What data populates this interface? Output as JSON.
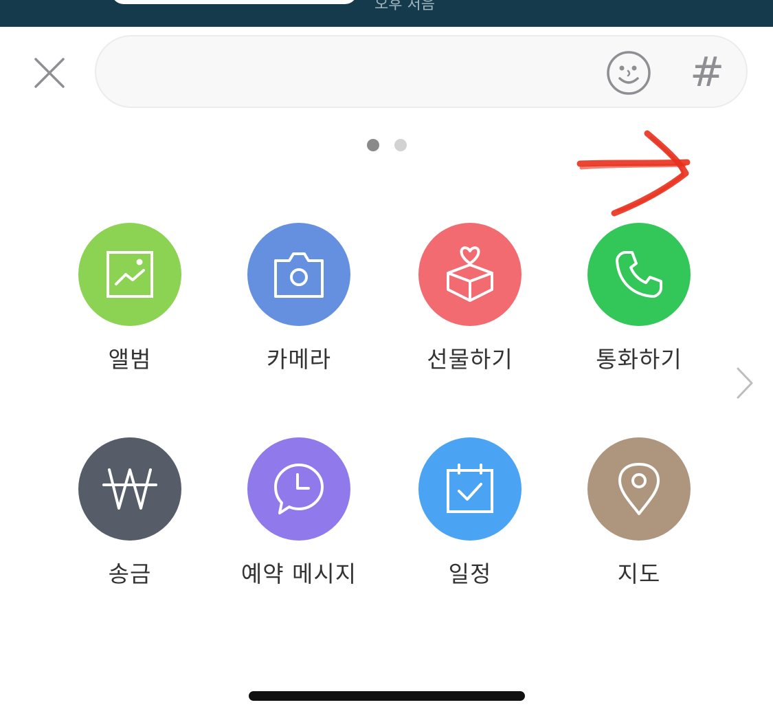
{
  "status_bar": {
    "partial_text": "오후 처음"
  },
  "composer": {
    "input_value": "",
    "input_placeholder": "",
    "hashtag_symbol": "#"
  },
  "icons": {
    "close": "close-icon",
    "emoji": "emoji-icon",
    "next": "chevron-right-icon"
  },
  "pagination": {
    "current": 1,
    "total": 2
  },
  "menu": {
    "items": [
      {
        "label": "앨범",
        "icon": "image-icon",
        "color": "#8cd253"
      },
      {
        "label": "카메라",
        "icon": "camera-icon",
        "color": "#6490df"
      },
      {
        "label": "선물하기",
        "icon": "gift-box-icon",
        "color": "#f26b71"
      },
      {
        "label": "통화하기",
        "icon": "phone-icon",
        "color": "#33c659"
      },
      {
        "label": "송금",
        "icon": "won-icon",
        "color": "#575d68"
      },
      {
        "label": "예약 메시지",
        "icon": "clock-message-icon",
        "color": "#9079ea"
      },
      {
        "label": "일정",
        "icon": "calendar-check-icon",
        "color": "#4aa3f3"
      },
      {
        "label": "지도",
        "icon": "map-pin-icon",
        "color": "#ae967e"
      }
    ]
  },
  "annotation": {
    "color": "#e8301c"
  }
}
